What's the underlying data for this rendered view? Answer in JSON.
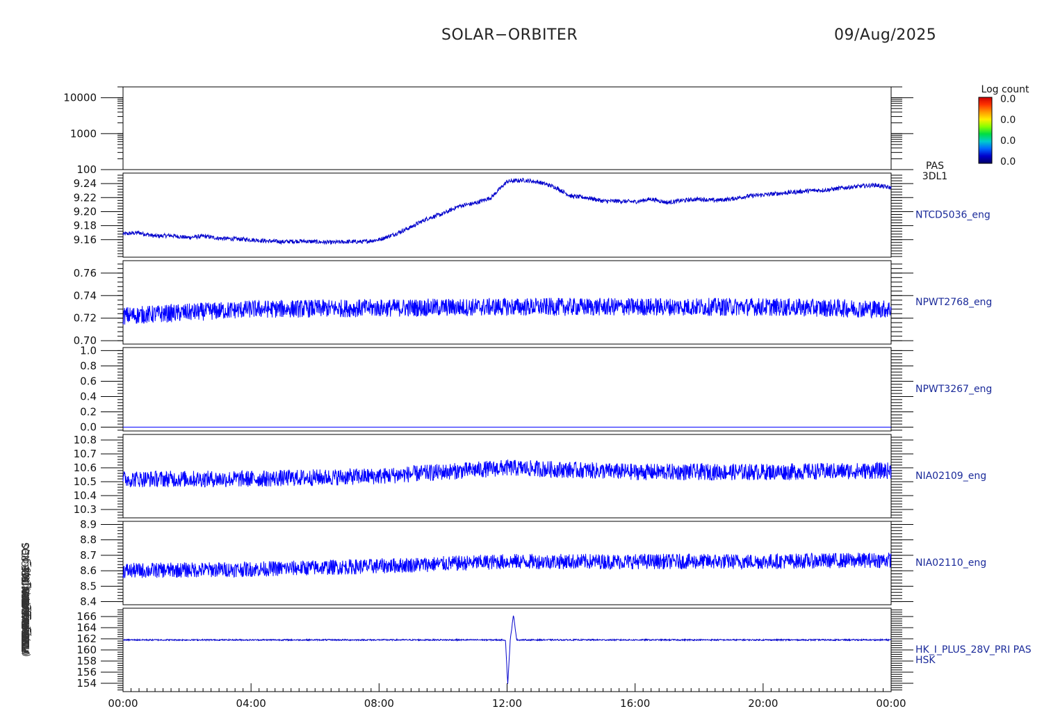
{
  "header": {
    "title": "SOLAR−ORBITER",
    "date": "09/Aug/2025"
  },
  "colorbar": {
    "title": "Log count",
    "labels": [
      "0.0",
      "0.0",
      "0.0",
      "0.0"
    ],
    "colors": [
      "#cc0000",
      "#ff3300",
      "#ff9900",
      "#ffee00",
      "#88ff00",
      "#00dd44",
      "#00cccc",
      "#0066ff",
      "#0000cc",
      "#000066"
    ]
  },
  "y_label_overlap": [
    "(nA)",
    "(mA)",
    "PDM_HK_IMON_FEE_NEG",
    "PDM_HK_IMON_FEE_POS",
    "THERM_CALIB (V)",
    "THR_CAL_CH4 (V)",
    "HK_SWA_EAS (V)",
    "ICU Temp (V)",
    "SWA-TEMP (V)",
    "TEMP_EAS1 (DegC)",
    "Log Count",
    "Approx Temp (DegC)",
    "Energy (eV)"
  ],
  "x_ticks": [
    "00:00",
    "04:00",
    "08:00",
    "12:00",
    "16:00",
    "20:00",
    "00:00"
  ],
  "chart_data": [
    {
      "type": "heatmap",
      "name_label": "PAS\n3DL1",
      "side_labels": [
        "PAS",
        "3DL1"
      ],
      "ylim": [
        100,
        20000
      ],
      "yscale": "log",
      "yticks": [
        {
          "v": 10000,
          "t": "10000"
        },
        {
          "v": 1000,
          "t": "1000"
        },
        {
          "v": 100,
          "t": "100"
        }
      ],
      "values": []
    },
    {
      "type": "line",
      "name_label": "NTCD5036_eng",
      "ylim": [
        9.135,
        9.255
      ],
      "yticks": [
        {
          "v": 9.24,
          "t": "9.24"
        },
        {
          "v": 9.22,
          "t": "9.22"
        },
        {
          "v": 9.2,
          "t": "9.20"
        },
        {
          "v": 9.18,
          "t": "9.18"
        },
        {
          "v": 9.16,
          "t": "9.16"
        }
      ],
      "x": [
        0,
        0.5,
        1,
        1.5,
        2,
        2.5,
        3,
        3.5,
        4,
        4.5,
        5,
        5.5,
        6,
        6.5,
        7,
        7.5,
        8,
        8.5,
        9,
        9.5,
        10,
        10.5,
        11,
        11.5,
        12,
        12.5,
        13,
        13.5,
        14,
        14.5,
        15,
        15.5,
        16,
        16.5,
        17,
        17.5,
        18,
        18.5,
        19,
        19.5,
        20,
        20.5,
        21,
        21.5,
        22,
        22.5,
        23,
        23.5,
        24
      ],
      "values": [
        9.168,
        9.17,
        9.165,
        9.166,
        9.163,
        9.165,
        9.162,
        9.161,
        9.16,
        9.158,
        9.157,
        9.158,
        9.157,
        9.156,
        9.157,
        9.157,
        9.16,
        9.168,
        9.178,
        9.19,
        9.197,
        9.208,
        9.212,
        9.22,
        9.243,
        9.245,
        9.242,
        9.235,
        9.222,
        9.22,
        9.215,
        9.215,
        9.214,
        9.218,
        9.213,
        9.216,
        9.218,
        9.216,
        9.218,
        9.222,
        9.224,
        9.226,
        9.228,
        9.23,
        9.231,
        9.234,
        9.236,
        9.238,
        9.234
      ],
      "noise": 0.003,
      "color": "#0000cc"
    },
    {
      "type": "line",
      "name_label": "NPWT2768_eng",
      "ylim": [
        0.697,
        0.771
      ],
      "yticks": [
        {
          "v": 0.76,
          "t": "0.76"
        },
        {
          "v": 0.74,
          "t": "0.74"
        },
        {
          "v": 0.72,
          "t": "0.72"
        },
        {
          "v": 0.7,
          "t": "0.70"
        }
      ],
      "x": [
        0,
        4,
        8,
        12,
        16,
        20,
        24
      ],
      "values": [
        0.722,
        0.728,
        0.729,
        0.73,
        0.73,
        0.73,
        0.728
      ],
      "noise": 0.008,
      "color": "#0000ff"
    },
    {
      "type": "line",
      "name_label": "NPWT3267_eng",
      "ylim": [
        -0.05,
        1.04
      ],
      "yticks": [
        {
          "v": 1.0,
          "t": "1.0"
        },
        {
          "v": 0.8,
          "t": "0.8"
        },
        {
          "v": 0.6,
          "t": "0.6"
        },
        {
          "v": 0.4,
          "t": "0.4"
        },
        {
          "v": 0.2,
          "t": "0.2"
        },
        {
          "v": 0.0,
          "t": "0.0"
        }
      ],
      "x": [
        0,
        24
      ],
      "values": [
        0.0,
        0.0
      ],
      "noise": 0.0,
      "color": "#0000ff"
    },
    {
      "type": "line",
      "name_label": "NIA02109_eng",
      "ylim": [
        10.24,
        10.84
      ],
      "yticks": [
        {
          "v": 10.8,
          "t": "10.8"
        },
        {
          "v": 10.7,
          "t": "10.7"
        },
        {
          "v": 10.6,
          "t": "10.6"
        },
        {
          "v": 10.5,
          "t": "10.5"
        },
        {
          "v": 10.4,
          "t": "10.4"
        },
        {
          "v": 10.3,
          "t": "10.3"
        }
      ],
      "x": [
        0,
        4,
        8,
        12,
        16,
        20,
        24
      ],
      "values": [
        10.52,
        10.52,
        10.54,
        10.6,
        10.57,
        10.57,
        10.58
      ],
      "noise": 0.06,
      "color": "#0000ff"
    },
    {
      "type": "line",
      "name_label": "NIA02110_eng",
      "ylim": [
        8.38,
        8.92
      ],
      "yticks": [
        {
          "v": 8.9,
          "t": "8.9"
        },
        {
          "v": 8.8,
          "t": "8.8"
        },
        {
          "v": 8.7,
          "t": "8.7"
        },
        {
          "v": 8.6,
          "t": "8.6"
        },
        {
          "v": 8.5,
          "t": "8.5"
        },
        {
          "v": 8.4,
          "t": "8.4"
        }
      ],
      "x": [
        0,
        4,
        8,
        12,
        16,
        20,
        24
      ],
      "values": [
        8.6,
        8.61,
        8.63,
        8.66,
        8.66,
        8.66,
        8.67
      ],
      "noise": 0.05,
      "color": "#0000ff"
    },
    {
      "type": "line",
      "name_label": "HK_I_PLUS_28V_PRI PAS\nHSK",
      "side_labels": [
        "HK_I_PLUS_28V_PRI PAS",
        "HSK"
      ],
      "ylim": [
        152.5,
        167.5
      ],
      "yticks": [
        {
          "v": 166,
          "t": "166"
        },
        {
          "v": 164,
          "t": "164"
        },
        {
          "v": 162,
          "t": "162"
        },
        {
          "v": 160,
          "t": "160"
        },
        {
          "v": 158,
          "t": "158"
        },
        {
          "v": 156,
          "t": "156"
        },
        {
          "v": 154,
          "t": "154"
        }
      ],
      "x": [
        0,
        11.95,
        12.02,
        12.1,
        12.2,
        12.3,
        24
      ],
      "values": [
        161.8,
        161.8,
        153.8,
        161.8,
        166.3,
        161.8,
        161.8
      ],
      "noise": 0.12,
      "color": "#0000cc"
    }
  ]
}
